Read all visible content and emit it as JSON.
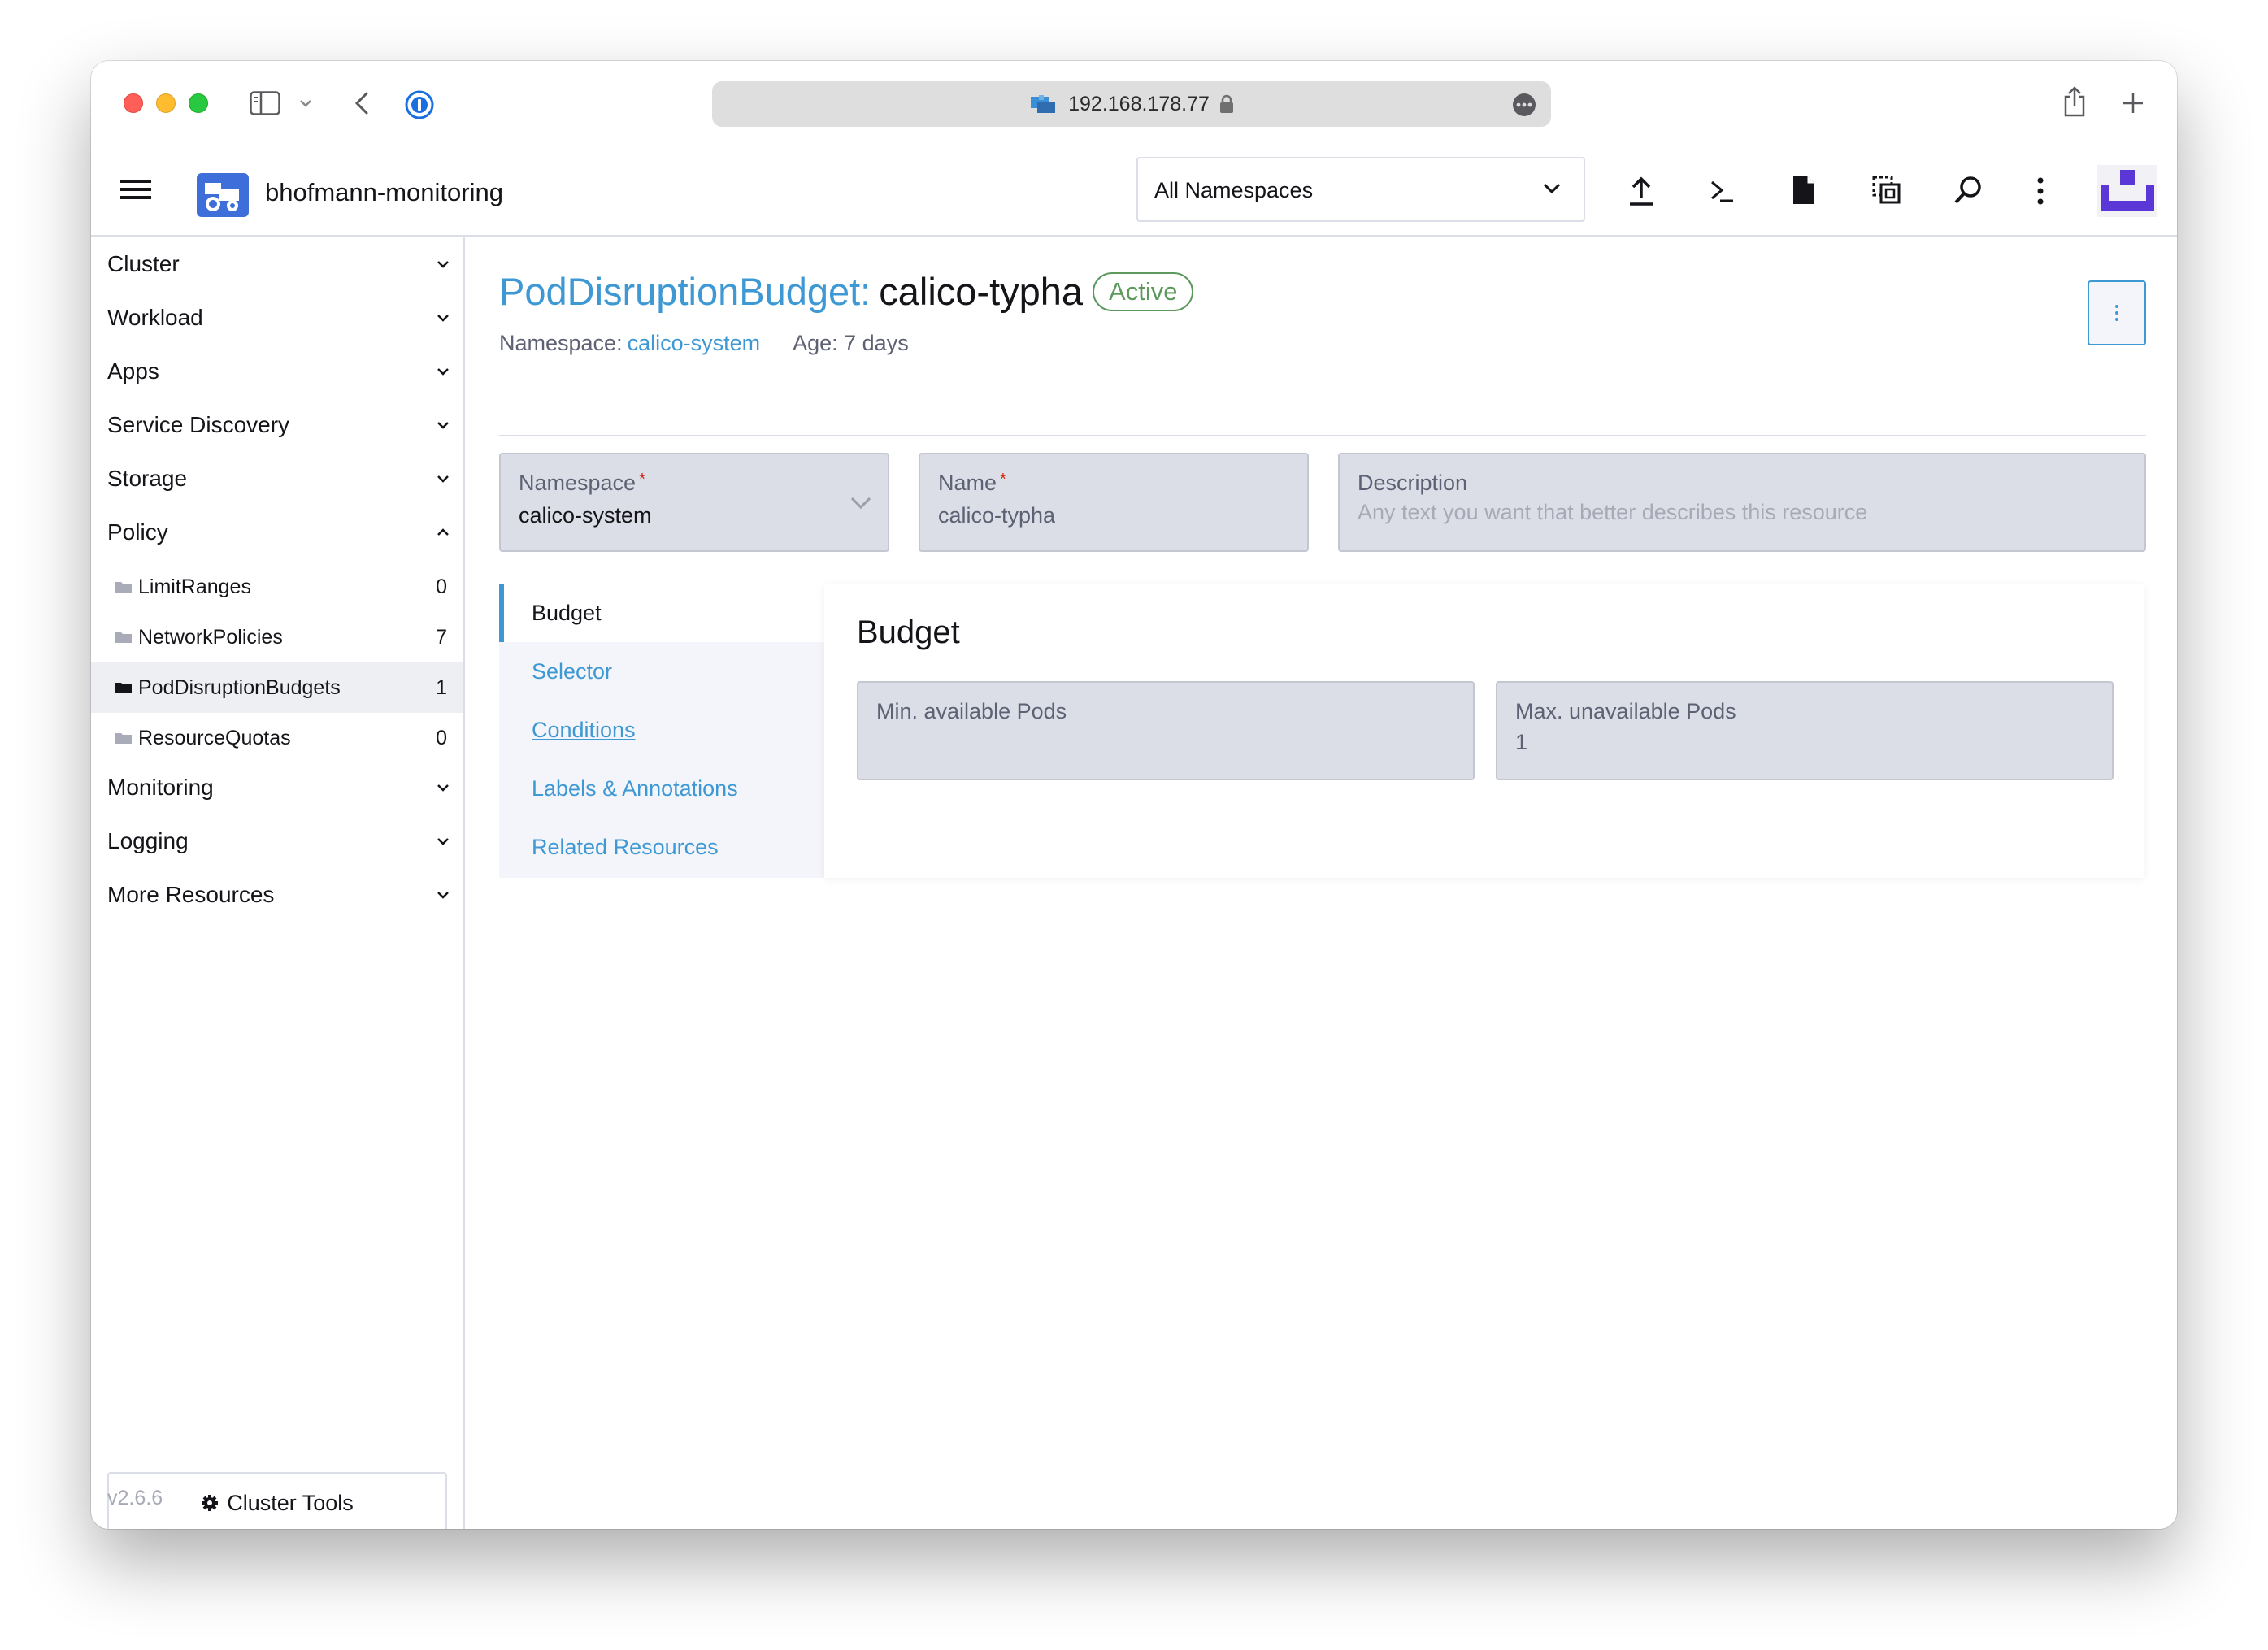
{
  "browser": {
    "url": "192.168.178.77"
  },
  "app": {
    "cluster_name": "bhofmann-monitoring",
    "namespace_select": "All Namespaces"
  },
  "sidebar": {
    "groups": [
      {
        "label": "Cluster"
      },
      {
        "label": "Workload"
      },
      {
        "label": "Apps"
      },
      {
        "label": "Service Discovery"
      },
      {
        "label": "Storage"
      },
      {
        "label": "Policy"
      }
    ],
    "policy_items": [
      {
        "label": "LimitRanges",
        "count": "0"
      },
      {
        "label": "NetworkPolicies",
        "count": "7"
      },
      {
        "label": "PodDisruptionBudgets",
        "count": "1"
      },
      {
        "label": "ResourceQuotas",
        "count": "0"
      }
    ],
    "groups_after": [
      {
        "label": "Monitoring"
      },
      {
        "label": "Logging"
      },
      {
        "label": "More Resources"
      }
    ],
    "cluster_tools": "Cluster Tools",
    "version": "v2.6.6"
  },
  "header": {
    "resource_type": "PodDisruptionBudget:",
    "resource_name": "calico-typha",
    "status": "Active",
    "namespace_label": "Namespace:",
    "namespace_value": "calico-system",
    "age": "Age: 7 days"
  },
  "form": {
    "namespace_label": "Namespace",
    "namespace_value": "calico-system",
    "name_label": "Name",
    "name_value": "calico-typha",
    "description_label": "Description",
    "description_placeholder": "Any text you want that better describes this resource"
  },
  "tabs": [
    {
      "label": "Budget"
    },
    {
      "label": "Selector"
    },
    {
      "label": "Conditions"
    },
    {
      "label": "Labels & Annotations"
    },
    {
      "label": "Related Resources"
    }
  ],
  "budget": {
    "title": "Budget",
    "min_label": "Min. available Pods",
    "min_value": "",
    "max_label": "Max. unavailable Pods",
    "max_value": "1"
  },
  "colors": {
    "accent": "#3d98d3",
    "active_green": "#5d995d",
    "rancher_purple": "#5b37d8"
  }
}
